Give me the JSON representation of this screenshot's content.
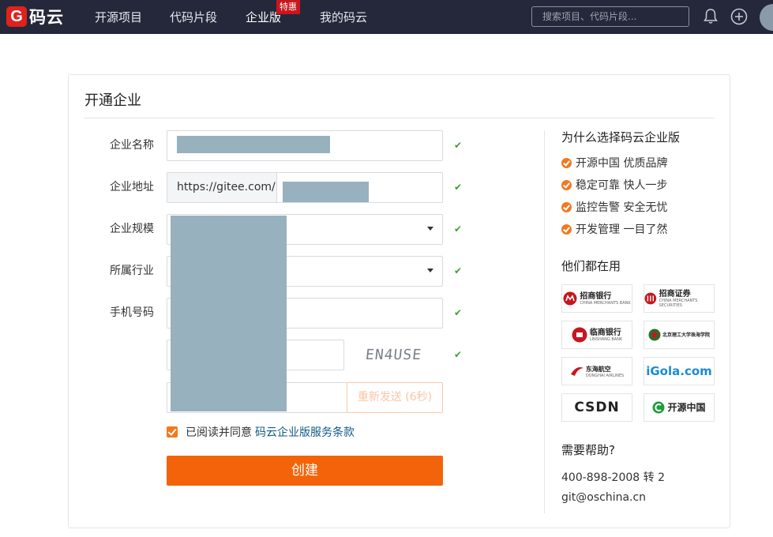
{
  "nav": {
    "logo_mark": "G",
    "logo_text": "码云",
    "items": [
      "开源项目",
      "代码片段",
      "企业版",
      "我的码云"
    ],
    "badge": "特惠",
    "search_placeholder": "搜索项目、代码片段..."
  },
  "card": {
    "title": "开通企业",
    "form": {
      "labels": [
        "企业名称",
        "企业地址",
        "企业规模",
        "所属行业",
        "手机号码"
      ],
      "url_prefix": "https://gitee.com/",
      "captcha": "EN4USE",
      "resend": "重新发送 (6秒)",
      "agree_text": "已阅读并同意",
      "agree_link": "码云企业版服务条款",
      "submit": "创建"
    },
    "sidebar": {
      "why_title": "为什么选择码云企业版",
      "reasons": [
        "开源中国 优质品牌",
        "稳定可靠 快人一步",
        "监控告警 安全无忧",
        "开发管理 一目了然"
      ],
      "users_title": "他们都在用",
      "logos": [
        {
          "name": "招商银行",
          "sub": "CHINA MERCHANTS BANK",
          "color": "#c8161e"
        },
        {
          "name": "招商证券",
          "sub": "CHINA MERCHANTS SECURITIES",
          "color": "#c8161e"
        },
        {
          "name": "临商银行",
          "sub": "LINSHANG BANK",
          "color": "#c8161e"
        },
        {
          "name": "北京理工大学珠海学院",
          "sub": "",
          "color": "#2f6b2c"
        },
        {
          "name": "东海航空",
          "sub": "DONGHAI AIRLINES",
          "color": "#c8161e"
        },
        {
          "name": "iGola.com",
          "sub": "",
          "color": "#1b8bd6"
        },
        {
          "name": "CSDN",
          "sub": "",
          "color": "#c8161e"
        },
        {
          "name": "开源中国",
          "sub": "",
          "color": "#1e9d3a"
        }
      ],
      "help_title": "需要帮助?",
      "phone": "400-898-2008 转 2",
      "email": "git@oschina.cn"
    }
  },
  "colors": {
    "nav_bg": "#25283a",
    "accent": "#f3640a",
    "check": "#3f9f38"
  }
}
